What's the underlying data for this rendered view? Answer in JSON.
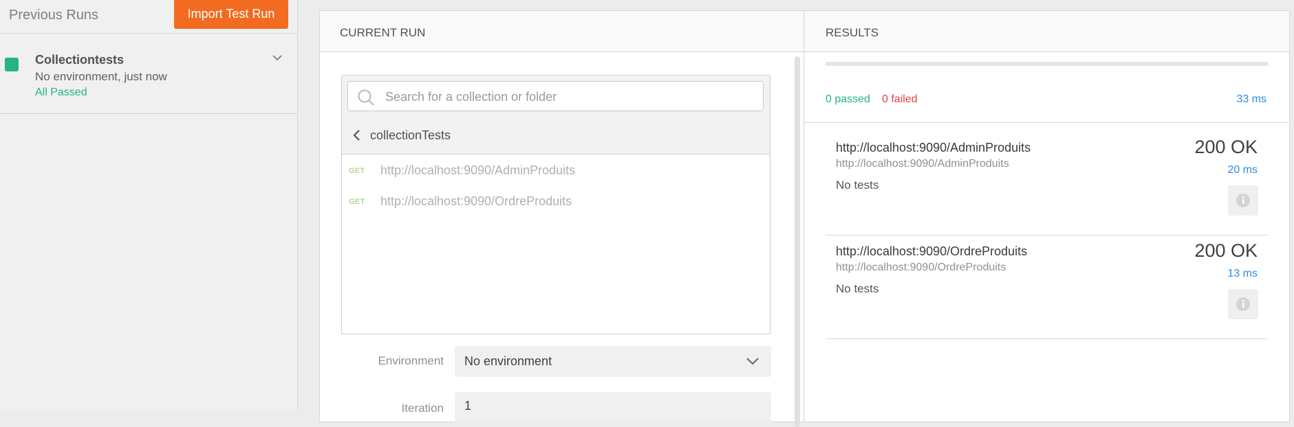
{
  "sidebar": {
    "title": "Previous Runs",
    "import_button": "Import Test Run",
    "runs": [
      {
        "name": "Collectiontests",
        "environment": "No environment, just now",
        "status": "All Passed",
        "status_color": "#26b47f"
      }
    ]
  },
  "current_run": {
    "header": "CURRENT RUN",
    "search": {
      "placeholder": "Search for a collection or folder",
      "value": ""
    },
    "breadcrumb": "collectionTests",
    "requests": [
      {
        "method": "GET",
        "url": "http://localhost:9090/AdminProduits"
      },
      {
        "method": "GET",
        "url": "http://localhost:9090/OrdreProduits"
      }
    ],
    "environment": {
      "label": "Environment",
      "value": "No environment"
    },
    "iteration": {
      "label": "Iteration",
      "value": "1"
    }
  },
  "results": {
    "header": "RESULTS",
    "passed": "0 passed",
    "failed": "0 failed",
    "total_time": "33 ms",
    "items": [
      {
        "name": "http://localhost:9090/AdminProduits",
        "url": "http://localhost:9090/AdminProduits",
        "tests": "No tests",
        "status": "200 OK",
        "time": "20 ms"
      },
      {
        "name": "http://localhost:9090/OrdreProduits",
        "url": "http://localhost:9090/OrdreProduits",
        "tests": "No tests",
        "status": "200 OK",
        "time": "13 ms"
      }
    ]
  },
  "colors": {
    "accent": "#f26b21",
    "pass": "#26b47f",
    "fail": "#e0443e",
    "time": "#2b8be0"
  },
  "icons": [
    "chevron-down-icon",
    "search-icon",
    "chevron-left-icon",
    "info-icon"
  ]
}
